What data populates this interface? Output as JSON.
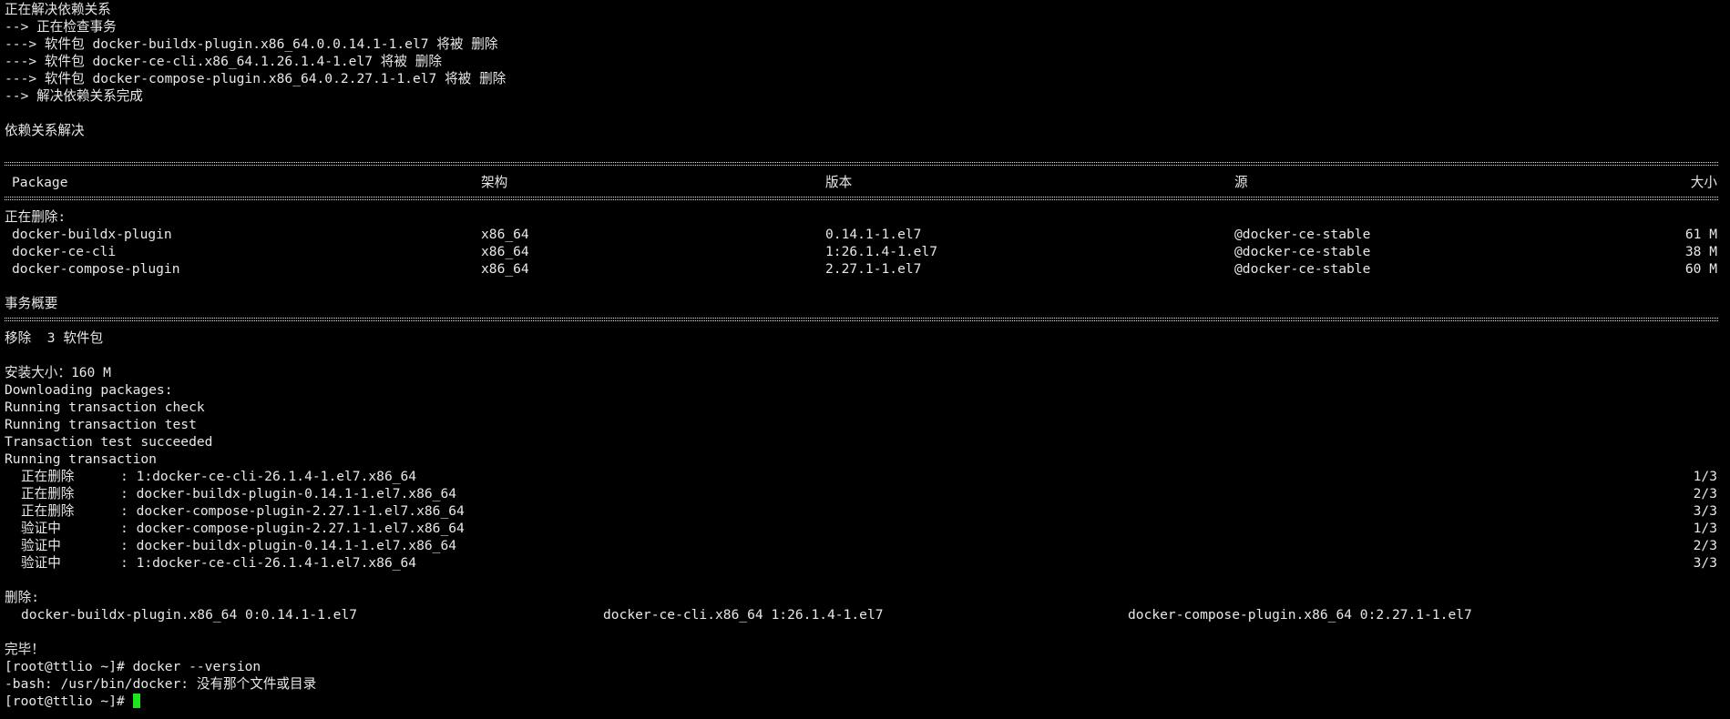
{
  "colors": {
    "background": "#000000",
    "foreground": "#e8e8e8",
    "cursor": "#1ee61e"
  },
  "resolve": {
    "l1": "正在解决依赖关系",
    "l2": "--> 正在检查事务",
    "l3": "---> 软件包 docker-buildx-plugin.x86_64.0.0.14.1-1.el7 将被 删除",
    "l4": "---> 软件包 docker-ce-cli.x86_64.1.26.1.4-1.el7 将被 删除",
    "l5": "---> 软件包 docker-compose-plugin.x86_64.0.2.27.1-1.el7 将被 删除",
    "l6": "--> 解决依赖关系完成",
    "l7": "依赖关系解决"
  },
  "table": {
    "headers": {
      "package": "Package",
      "arch": "架构",
      "version": "版本",
      "repo": "源",
      "size": "大小"
    },
    "section_label": "正在删除:",
    "rows": [
      {
        "name": "docker-buildx-plugin",
        "arch": "x86_64",
        "version": "0.14.1-1.el7",
        "repo": "@docker-ce-stable",
        "size": "61 M"
      },
      {
        "name": "docker-ce-cli",
        "arch": "x86_64",
        "version": "1:26.1.4-1.el7",
        "repo": "@docker-ce-stable",
        "size": "38 M"
      },
      {
        "name": "docker-compose-plugin",
        "arch": "x86_64",
        "version": "2.27.1-1.el7",
        "repo": "@docker-ce-stable",
        "size": "60 M"
      }
    ]
  },
  "summary": {
    "title": "事务概要",
    "remove": "移除  3 软件包",
    "install_size": "安装大小：160 M",
    "downloading": "Downloading packages:",
    "check": "Running transaction check",
    "test": "Running transaction test",
    "succeeded": "Transaction test succeeded",
    "running": "Running transaction"
  },
  "steps": [
    {
      "action": "正在删除",
      "pkg": "1:docker-ce-cli-26.1.4-1.el7.x86_64",
      "progress": "1/3"
    },
    {
      "action": "正在删除",
      "pkg": "docker-buildx-plugin-0.14.1-1.el7.x86_64",
      "progress": "2/3"
    },
    {
      "action": "正在删除",
      "pkg": "docker-compose-plugin-2.27.1-1.el7.x86_64",
      "progress": "3/3"
    },
    {
      "action": "验证中",
      "pkg": "docker-compose-plugin-2.27.1-1.el7.x86_64",
      "progress": "1/3"
    },
    {
      "action": "验证中",
      "pkg": "docker-buildx-plugin-0.14.1-1.el7.x86_64",
      "progress": "2/3"
    },
    {
      "action": "验证中",
      "pkg": "1:docker-ce-cli-26.1.4-1.el7.x86_64",
      "progress": "3/3"
    }
  ],
  "removed": {
    "label": "删除:",
    "items": [
      "docker-buildx-plugin.x86_64 0:0.14.1-1.el7",
      "docker-ce-cli.x86_64 1:26.1.4-1.el7",
      "docker-compose-plugin.x86_64 0:2.27.1-1.el7"
    ]
  },
  "completion": "完毕！",
  "shell": {
    "prompt1": "[root@ttlio ~]# ",
    "command1": "docker --version",
    "error": "-bash: /usr/bin/docker: 没有那个文件或目录",
    "prompt2": "[root@ttlio ~]# ",
    "input": ""
  }
}
